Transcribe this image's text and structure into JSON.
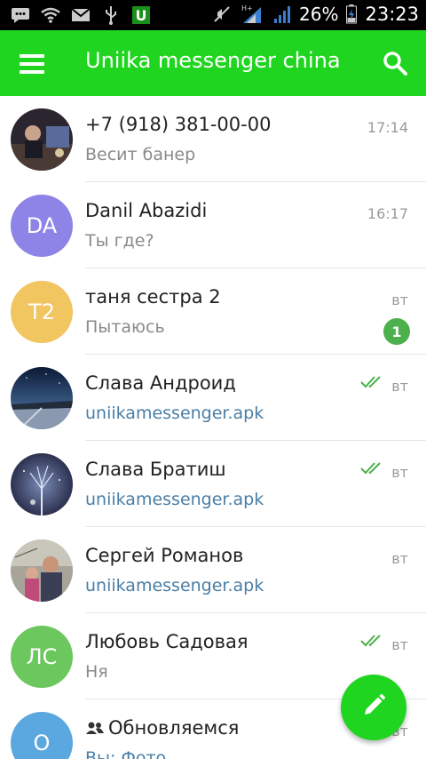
{
  "status_bar": {
    "battery_percent": "26%",
    "time": "23:23",
    "signal_type": "H+",
    "icons": [
      "message-icon",
      "wifi-icon",
      "gmail-icon",
      "usb-icon",
      "app-u-icon",
      "mute-icon",
      "signal-icon",
      "battery-icon"
    ]
  },
  "app_bar": {
    "title": "Uniika messenger china",
    "menu_icon": "hamburger-menu-icon",
    "search_icon": "search-icon",
    "color": "#1fd51f"
  },
  "chats": [
    {
      "avatar_type": "photo",
      "name": "+7 (918) 381-00-00",
      "message": "Весит банер",
      "time": "17:14",
      "message_is_link": false,
      "read_checks": false,
      "unread": ""
    },
    {
      "avatar_type": "initials",
      "initials": "DA",
      "avatar_color": "#8e83e6",
      "name": "Danil Abazidi",
      "message": "Ты где?",
      "time": "16:17",
      "message_is_link": false,
      "read_checks": false,
      "unread": ""
    },
    {
      "avatar_type": "initials",
      "initials": "T2",
      "avatar_color": "#f1c560",
      "name": "таня сестра 2",
      "message": "Пытаюсь",
      "time": "вт",
      "message_is_link": false,
      "read_checks": false,
      "unread": "1"
    },
    {
      "avatar_type": "photo",
      "name": "Слава Андроид",
      "message": "uniikamessenger.apk",
      "time": "вт",
      "message_is_link": true,
      "read_checks": true,
      "unread": ""
    },
    {
      "avatar_type": "photo",
      "name": "Слава Братиш",
      "message": "uniikamessenger.apk",
      "time": "вт",
      "message_is_link": true,
      "read_checks": true,
      "unread": ""
    },
    {
      "avatar_type": "photo",
      "name": "Сергей Романов",
      "message": "uniikamessenger.apk",
      "time": "вт",
      "message_is_link": true,
      "read_checks": false,
      "unread": ""
    },
    {
      "avatar_type": "initials",
      "initials": "ЛС",
      "avatar_color": "#6cc75e",
      "name": "Любовь Садовая",
      "message": "Ня",
      "time": "вт",
      "message_is_link": false,
      "read_checks": true,
      "unread": ""
    },
    {
      "avatar_type": "initials",
      "initials": "О",
      "avatar_color": "#5ba7e0",
      "name": "Обновляемся",
      "message": "Вы: Фото",
      "time": "вт",
      "message_is_link": true,
      "read_checks": false,
      "unread": "",
      "is_group": true
    }
  ],
  "fab": {
    "icon": "pencil-icon"
  }
}
